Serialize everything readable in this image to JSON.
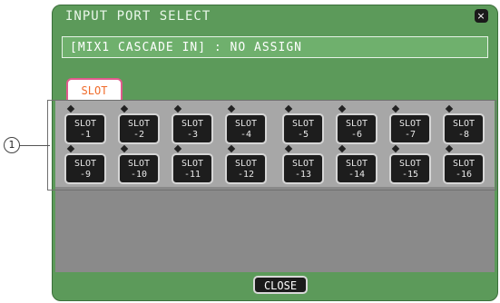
{
  "window": {
    "title": "INPUT PORT SELECT",
    "close_glyph": "×",
    "status_text": "[MIX1 CASCADE IN] : NO ASSIGN",
    "tab": "SLOT",
    "close_button": "CLOSE"
  },
  "slots": [
    {
      "line1": "SLOT",
      "line2": "-1"
    },
    {
      "line1": "SLOT",
      "line2": "-2"
    },
    {
      "line1": "SLOT",
      "line2": "-3"
    },
    {
      "line1": "SLOT",
      "line2": "-4"
    },
    {
      "line1": "SLOT",
      "line2": "-5"
    },
    {
      "line1": "SLOT",
      "line2": "-6"
    },
    {
      "line1": "SLOT",
      "line2": "-7"
    },
    {
      "line1": "SLOT",
      "line2": "-8"
    },
    {
      "line1": "SLOT",
      "line2": "-9"
    },
    {
      "line1": "SLOT",
      "line2": "-10"
    },
    {
      "line1": "SLOT",
      "line2": "-11"
    },
    {
      "line1": "SLOT",
      "line2": "-12"
    },
    {
      "line1": "SLOT",
      "line2": "-13"
    },
    {
      "line1": "SLOT",
      "line2": "-14"
    },
    {
      "line1": "SLOT",
      "line2": "-15"
    },
    {
      "line1": "SLOT",
      "line2": "-16"
    }
  ],
  "callout": {
    "number": "1"
  },
  "icons": {
    "close": "close-icon",
    "indicator": "diamond-indicator-icon"
  },
  "colors": {
    "panel_green": "#5c9a5a",
    "tab_text": "#f06b2a",
    "tab_border": "#e05b8c"
  }
}
